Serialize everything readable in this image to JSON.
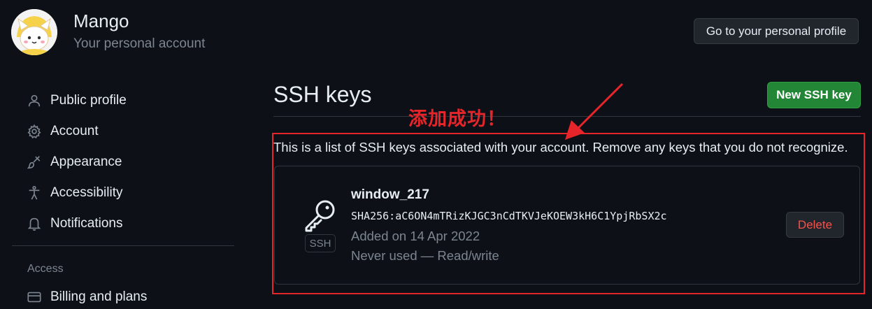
{
  "header": {
    "user_name": "Mango",
    "user_subtitle": "Your personal account",
    "profile_button": "Go to your personal profile"
  },
  "sidebar": {
    "items": [
      {
        "label": "Public profile",
        "icon": "person-icon"
      },
      {
        "label": "Account",
        "icon": "gear-icon"
      },
      {
        "label": "Appearance",
        "icon": "paintbrush-icon"
      },
      {
        "label": "Accessibility",
        "icon": "accessibility-icon"
      },
      {
        "label": "Notifications",
        "icon": "bell-icon"
      }
    ],
    "section_access": "Access",
    "billing_label": "Billing and plans"
  },
  "main": {
    "title": "SSH keys",
    "new_key_button": "New SSH key",
    "description": "This is a list of SSH keys associated with your account. Remove any keys that you do not recognize.",
    "annotation": "添加成功！",
    "keys": [
      {
        "name": "window_217",
        "fingerprint": "SHA256:aC6ON4mTRizKJGC3nCdTKVJeKOEW3kH6C1YpjRbSX2c",
        "added": "Added on 14 Apr 2022",
        "usage": "Never used — Read/write",
        "type_badge": "SSH",
        "delete_label": "Delete"
      }
    ]
  },
  "colors": {
    "background": "#0d1117",
    "primary_button": "#238636",
    "danger_text": "#f85149",
    "annotation_red": "#e5252a",
    "muted_text": "#7d8590"
  }
}
